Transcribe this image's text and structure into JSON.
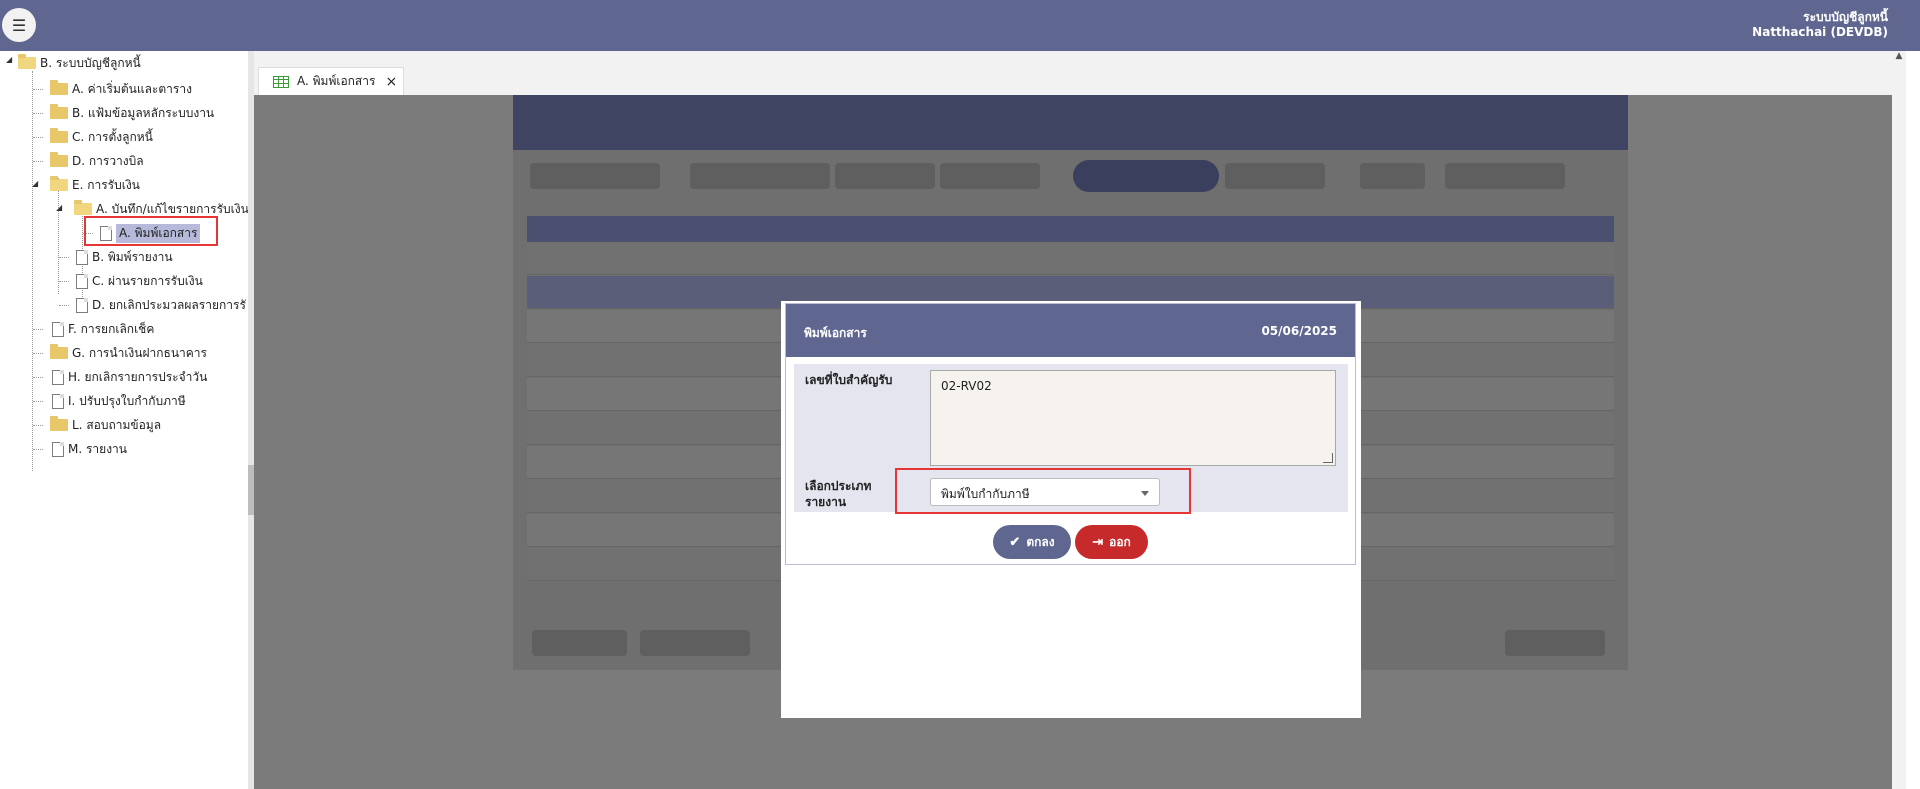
{
  "header": {
    "menu_icon": "hamburger-icon",
    "system_name": "ระบบบัญชีลูกหนี้",
    "user": "Natthachai (DEVDB)"
  },
  "sidebar": {
    "root": "B. ระบบบัญชีลูกหนี้",
    "items": [
      {
        "label": "A. ค่าเริ่มต้นและตาราง"
      },
      {
        "label": "B. แฟ้มข้อมูลหลักระบบงาน"
      },
      {
        "label": "C. การตั้งลูกหนี้"
      },
      {
        "label": "D. การวางบิล"
      },
      {
        "label": "E. การรับเงิน"
      },
      {
        "label": "A. บันทึก/แก้ไขรายการรับเงิน"
      },
      {
        "label": "A. พิมพ์เอกสาร"
      },
      {
        "label": "B. พิมพ์รายงาน"
      },
      {
        "label": "C. ผ่านรายการรับเงิน"
      },
      {
        "label": "D. ยกเลิกประมวลผลรายการรั"
      },
      {
        "label": "F. การยกเลิกเช็ค"
      },
      {
        "label": "G. การนำเงินฝากธนาคาร"
      },
      {
        "label": "H. ยกเลิกรายการประจำวัน"
      },
      {
        "label": "I. ปรับปรุงใบกำกับภาษี"
      },
      {
        "label": "L. สอบถามข้อมูล"
      },
      {
        "label": "M. รายงาน"
      }
    ]
  },
  "tabs": [
    {
      "label": "A. พิมพ์เอกสาร",
      "close": "×"
    }
  ],
  "modal": {
    "title": "พิมพ์เอกสาร",
    "date": "05/06/2025",
    "receipt_label": "เลขที่ใบสำคัญรับ",
    "receipt_value": "02-RV02",
    "report_type_label_1": "เลือกประเภท",
    "report_type_label_2": "รายงาน",
    "report_type_value": "พิมพ์ใบกำกับภาษี",
    "ok_label": "ตกลง",
    "exit_label": "ออก"
  },
  "colors": {
    "header": "#5f6791",
    "exit_button": "#c62a2a",
    "highlight": "#e53535"
  }
}
